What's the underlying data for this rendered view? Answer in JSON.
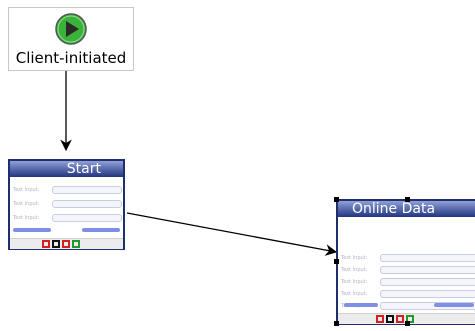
{
  "nodes": {
    "start_event": {
      "label": "Client-initiated"
    },
    "start_form": {
      "title": "Start",
      "field_labels": [
        "Text Input:",
        "Text Input:",
        "Text Input:"
      ]
    },
    "online_form": {
      "title": "Online Data",
      "field_labels": [
        "Text Input:",
        "Text Input:",
        "Text Input:",
        "Text Input:",
        "Text Input:"
      ]
    }
  },
  "colors": {
    "play": "#3bb33b",
    "title_bar": "#22347e",
    "button": "#7f8fe6",
    "marker_red": "#d42020",
    "marker_green": "#1f9a2a"
  }
}
